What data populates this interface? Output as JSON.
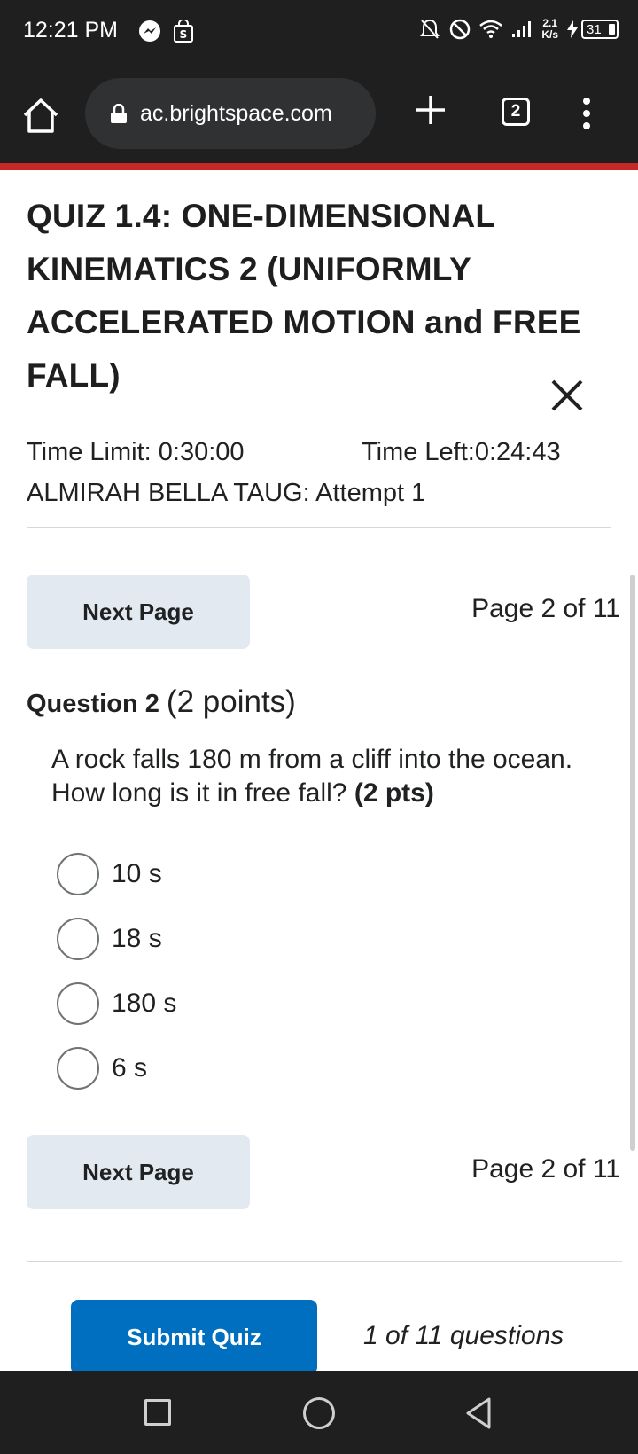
{
  "status_bar": {
    "time": "12:21 PM",
    "speed_value": "2.1",
    "speed_unit": "K/s",
    "battery": "31",
    "icons": [
      "messenger-icon",
      "shop-icon",
      "mute-icon",
      "dnd-icon",
      "wifi-icon",
      "signal-icon",
      "charging-icon"
    ]
  },
  "browser": {
    "url": "ac.brightspace.com",
    "tab_count": "2",
    "icons": [
      "home-icon",
      "lock-icon",
      "plus-icon",
      "kebab-menu-icon"
    ]
  },
  "quiz": {
    "title": "QUIZ 1.4: ONE-DIMENSIONAL KINEMATICS 2 (UNIFORMLY ACCELERATED MOTION and FREE FALL)",
    "time_limit": "Time Limit: 0:30:00",
    "time_left": "Time Left:0:24:43",
    "attempt": "ALMIRAH BELLA TAUG: Attempt 1"
  },
  "pagination": {
    "next_label": "Next Page",
    "page_info": "Page 2 of 11"
  },
  "question": {
    "label": "Question 2",
    "points": "(2 points)",
    "text": "A rock falls 180 m from a cliff into the ocean. How long is it in free fall?",
    "pts": "(2 pts)",
    "options": [
      "10 s",
      "18 s",
      "180 s",
      "6 s"
    ]
  },
  "footer": {
    "submit_label": "Submit Quiz",
    "question_count": "1 of 11 questions"
  },
  "colors": {
    "accent_red": "#c62828",
    "submit_blue": "#006fbf",
    "button_gray": "#e3e9f1",
    "dark_bar": "#1f1f1f"
  }
}
